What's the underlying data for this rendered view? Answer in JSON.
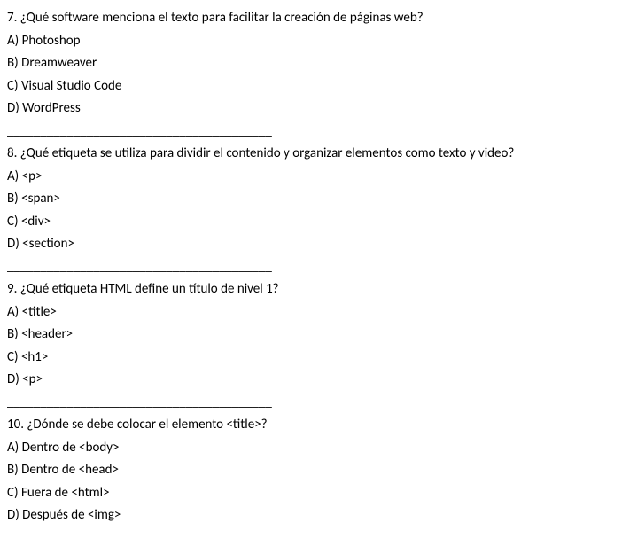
{
  "separator": "________________________________________",
  "questions": [
    {
      "number": "7",
      "text": "¿Qué software menciona el texto para facilitar la creación de páginas web?",
      "options": {
        "A": "Photoshop",
        "B": "Dreamweaver",
        "C": "Visual Studio Code",
        "D": "WordPress"
      }
    },
    {
      "number": "8",
      "text": "¿Qué etiqueta se utiliza para dividir el contenido y organizar elementos como texto y video?",
      "options": {
        "A": "<p>",
        "B": "<span>",
        "C": "<div>",
        "D": "<section>"
      }
    },
    {
      "number": "9",
      "text": "¿Qué etiqueta HTML define un título de nivel 1?",
      "options": {
        "A": "<title>",
        "B": "<header>",
        "C": "<h1>",
        "D": "<p>"
      }
    },
    {
      "number": "10",
      "text": "¿Dónde se debe colocar el elemento <title>?",
      "options": {
        "A": "Dentro de <body>",
        "B": "Dentro de <head>",
        "C": "Fuera de <html>",
        "D": "Después de <img>"
      }
    }
  ]
}
